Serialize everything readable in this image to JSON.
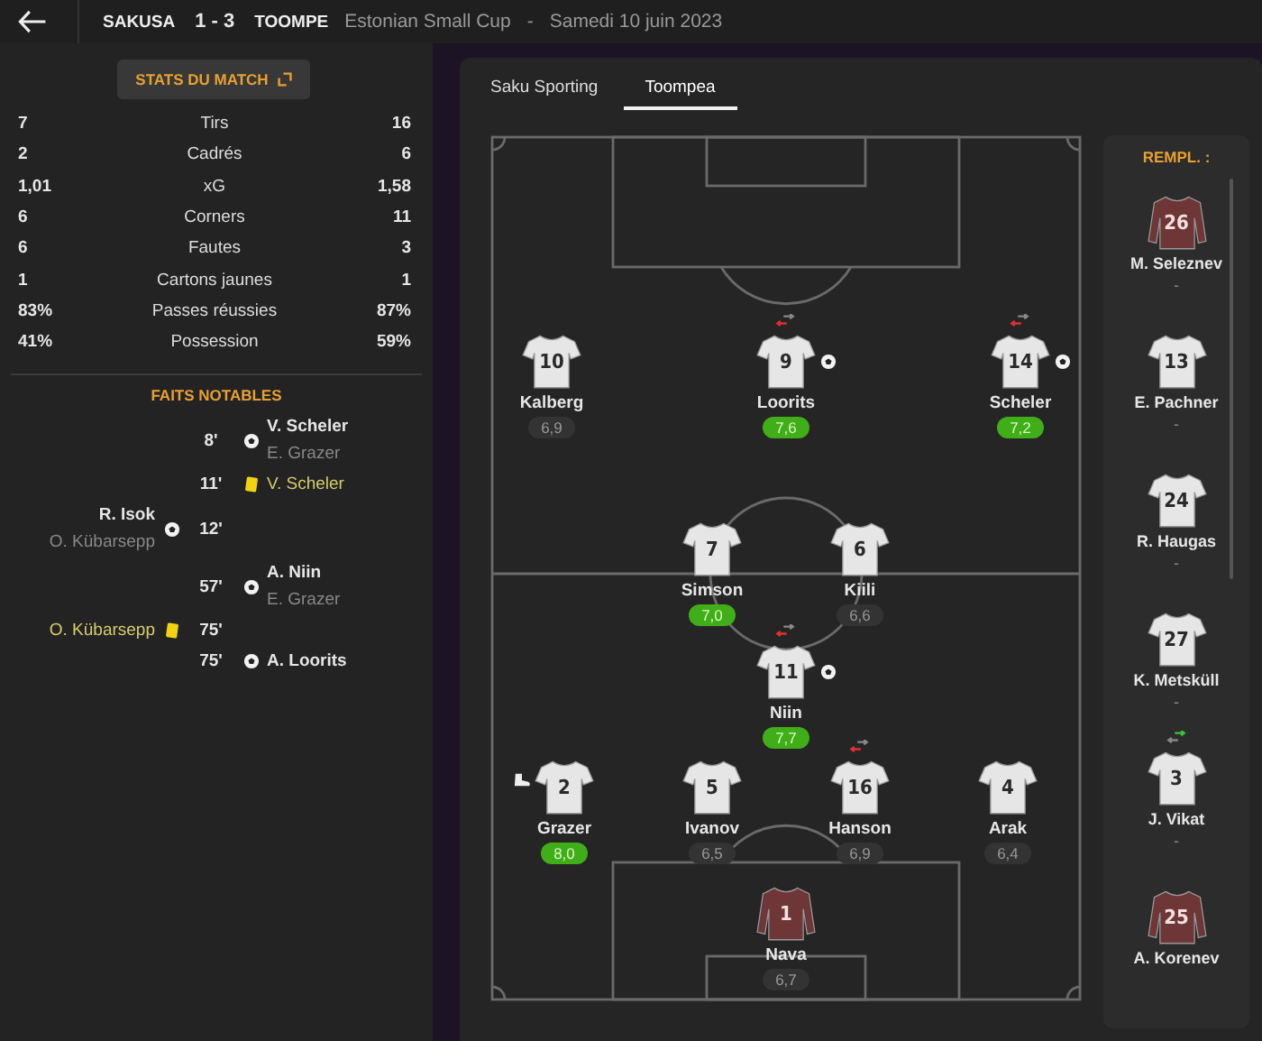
{
  "header": {
    "home": "SAKUSA",
    "score": "1 - 3",
    "away": "TOOMPE",
    "competition": "Estonian Small Cup",
    "separator": "-",
    "date": "Samedi 10 juin 2023"
  },
  "stats_button": "STATS DU MATCH",
  "stats": [
    {
      "label": "Tirs",
      "home": "7",
      "away": "16"
    },
    {
      "label": "Cadrés",
      "home": "2",
      "away": "6"
    },
    {
      "label": "xG",
      "home": "1,01",
      "away": "1,58"
    },
    {
      "label": "Corners",
      "home": "6",
      "away": "11"
    },
    {
      "label": "Fautes",
      "home": "6",
      "away": "3"
    },
    {
      "label": "Cartons jaunes",
      "home": "1",
      "away": "1"
    },
    {
      "label": "Passes réussies",
      "home": "83%",
      "away": "87%"
    },
    {
      "label": "Possession",
      "home": "41%",
      "away": "59%"
    }
  ],
  "events_title": "FAITS NOTABLES",
  "events": [
    {
      "minute": "8'",
      "away": {
        "kind": "goal",
        "player": "V. Scheler",
        "assist": "E. Grazer"
      }
    },
    {
      "minute": "11'",
      "away": {
        "kind": "yellow",
        "player": "V. Scheler"
      }
    },
    {
      "minute": "12'",
      "home": {
        "kind": "goal",
        "player": "R. Isok",
        "assist": "O. Kübarsepp"
      }
    },
    {
      "minute": "57'",
      "away": {
        "kind": "goal",
        "player": "A. Niin",
        "assist": "E. Grazer"
      }
    },
    {
      "minute": "75'",
      "home": {
        "kind": "yellow",
        "player": "O. Kübarsepp"
      }
    },
    {
      "minute": "75'",
      "away": {
        "kind": "goal",
        "player": "A. Loorits"
      }
    }
  ],
  "tabs": [
    {
      "label": "Saku Sporting",
      "selected": false
    },
    {
      "label": "Toompea",
      "selected": true
    }
  ],
  "lines": [
    {
      "players": [
        {
          "number": "10",
          "name": "Kalberg",
          "rating": "6,9",
          "highlight": false,
          "kind": "outfield"
        },
        {
          "number": "9",
          "name": "Loorits",
          "rating": "7,6",
          "highlight": true,
          "kind": "outfield",
          "events": [
            {
              "kind": "subbed_off"
            },
            {
              "kind": "goal"
            }
          ]
        },
        {
          "number": "14",
          "name": "Scheler",
          "rating": "7,2",
          "highlight": true,
          "kind": "outfield",
          "events": [
            {
              "kind": "subbed_off"
            },
            {
              "kind": "goal"
            }
          ]
        }
      ]
    },
    {
      "players": [
        {
          "number": "7",
          "name": "Simson",
          "rating": "7,0",
          "highlight": true,
          "kind": "outfield"
        },
        {
          "number": "6",
          "name": "Kiili",
          "rating": "6,6",
          "highlight": false,
          "kind": "outfield"
        }
      ]
    },
    {
      "players": [
        {
          "number": "11",
          "name": "Niin",
          "rating": "7,7",
          "highlight": true,
          "kind": "outfield",
          "events": [
            {
              "kind": "subbed_off"
            },
            {
              "kind": "goal"
            }
          ]
        }
      ]
    },
    {
      "players": [
        {
          "number": "2",
          "name": "Grazer",
          "rating": "8,0",
          "highlight": true,
          "kind": "outfield",
          "events": [
            {
              "kind": "assist"
            }
          ]
        },
        {
          "number": "5",
          "name": "Ivanov",
          "rating": "6,5",
          "highlight": false,
          "kind": "outfield"
        },
        {
          "number": "16",
          "name": "Hanson",
          "rating": "6,9",
          "highlight": false,
          "kind": "outfield",
          "events": [
            {
              "kind": "subbed_off"
            }
          ]
        },
        {
          "number": "4",
          "name": "Arak",
          "rating": "6,4",
          "highlight": false,
          "kind": "outfield"
        }
      ]
    },
    {
      "players": [
        {
          "number": "1",
          "name": "Nava",
          "rating": "6,7",
          "highlight": false,
          "kind": "keeper"
        }
      ]
    }
  ],
  "subs_title": "REMPL. :",
  "subs": [
    {
      "number": "26",
      "name": "M. Seleznev",
      "rating": "-",
      "kind": "keeper"
    },
    {
      "number": "13",
      "name": "E. Pachner",
      "rating": "-",
      "kind": "outfield"
    },
    {
      "number": "24",
      "name": "R. Haugas",
      "rating": "-",
      "kind": "outfield"
    },
    {
      "number": "27",
      "name": "K. Metsküll",
      "rating": "-",
      "kind": "outfield"
    },
    {
      "number": "3",
      "name": "J. Vikat",
      "rating": "-",
      "kind": "outfield",
      "events": [
        {
          "kind": "subbed_on"
        }
      ]
    },
    {
      "number": "25",
      "name": "A. Korenev",
      "kind": "keeper"
    }
  ]
}
